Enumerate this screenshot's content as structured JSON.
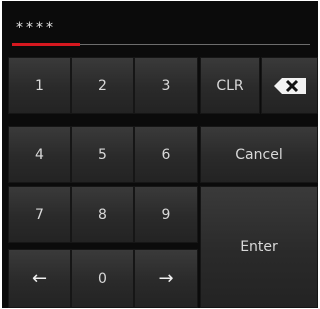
{
  "display": {
    "value": "****"
  },
  "keypad": {
    "digits": {
      "one": "1",
      "two": "2",
      "three": "3",
      "four": "4",
      "five": "5",
      "six": "6",
      "seven": "7",
      "eight": "8",
      "nine": "9",
      "zero": "0"
    },
    "left_arrow": "←",
    "right_arrow": "→",
    "clear_label": "CLR",
    "backspace_icon": "backspace-icon",
    "cancel_label": "Cancel",
    "enter_label": "Enter"
  },
  "colors": {
    "panel_background": "#0b0b0b",
    "key_background": "#2e2e2e",
    "focus_underline": "#d6181f",
    "text": "#d9d9d9"
  }
}
